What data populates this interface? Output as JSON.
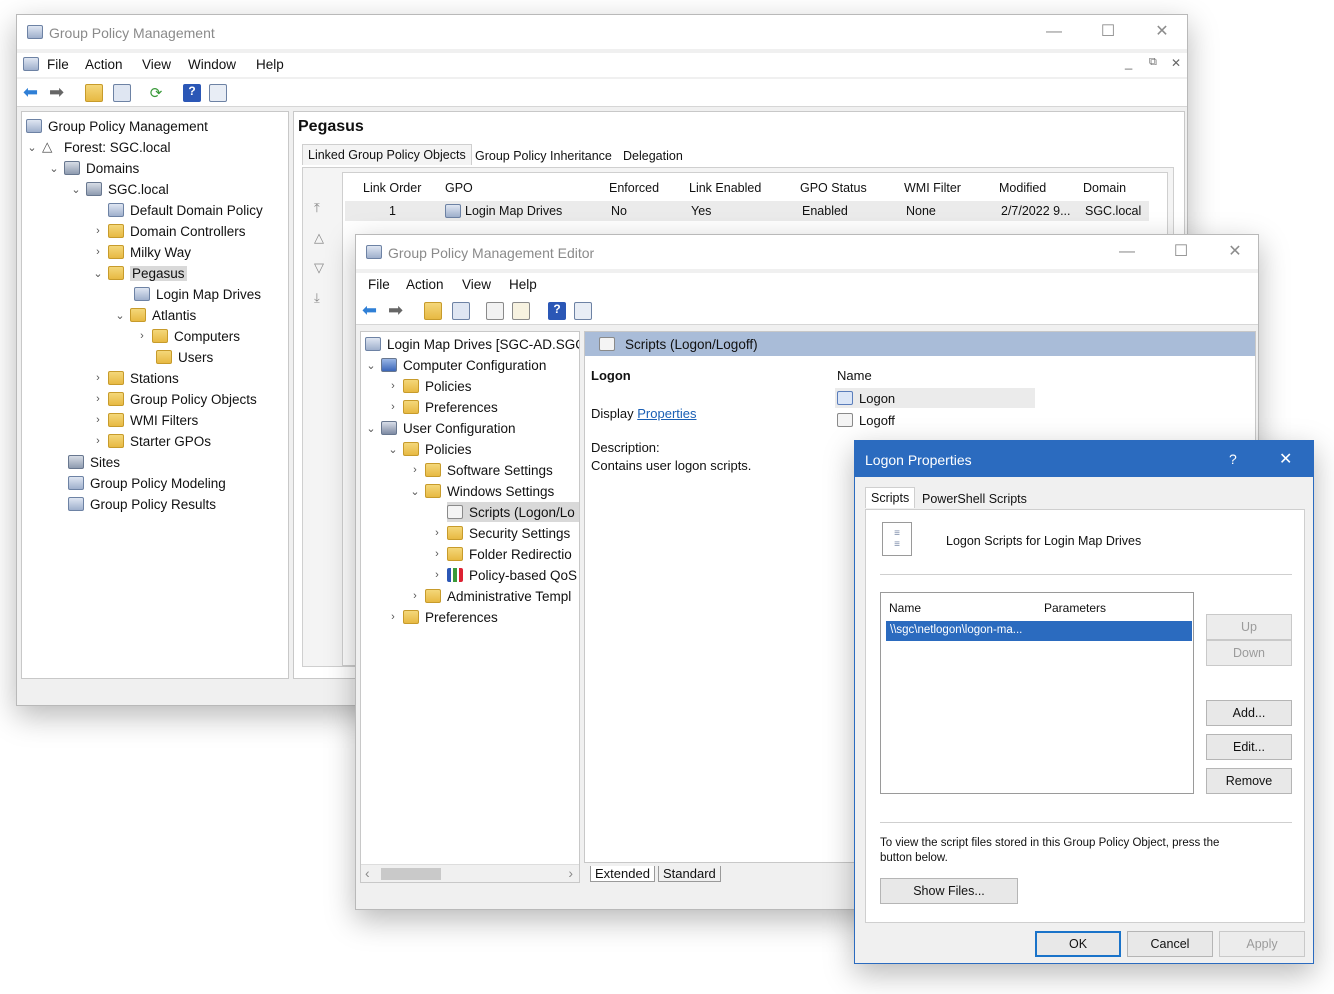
{
  "gpm": {
    "title": "Group Policy Management",
    "menu": [
      "File",
      "Action",
      "View",
      "Window",
      "Help"
    ],
    "tree": {
      "root": "Group Policy Management",
      "forest": "Forest: SGC.local",
      "domains": "Domains",
      "domain": "SGC.local",
      "default_policy": "Default Domain Policy",
      "dc": "Domain Controllers",
      "milky": "Milky Way",
      "pegasus": "Pegasus",
      "login_map": "Login Map Drives",
      "atlantis": "Atlantis",
      "computers": "Computers",
      "users": "Users",
      "stations": "Stations",
      "gpo": "Group Policy Objects",
      "wmi": "WMI Filters",
      "starter": "Starter GPOs",
      "sites": "Sites",
      "modeling": "Group Policy Modeling",
      "results": "Group Policy Results"
    },
    "content_title": "Pegasus",
    "tabs": [
      "Linked Group Policy Objects",
      "Group Policy Inheritance",
      "Delegation"
    ],
    "columns": [
      "Link Order",
      "GPO",
      "Enforced",
      "Link Enabled",
      "GPO Status",
      "WMI Filter",
      "Modified",
      "Domain"
    ],
    "rows": [
      {
        "link_order": "1",
        "gpo": "Login Map Drives",
        "enforced": "No",
        "link_enabled": "Yes",
        "status": "Enabled",
        "wmi": "None",
        "modified": "2/7/2022 9...",
        "domain": "SGC.local"
      }
    ]
  },
  "editor": {
    "title": "Group Policy Management Editor",
    "menu": [
      "File",
      "Action",
      "View",
      "Help"
    ],
    "tree": {
      "root": "Login Map Drives [SGC-AD.SGC.L",
      "computer_config": "Computer Configuration",
      "policies": "Policies",
      "preferences": "Preferences",
      "user_config": "User Configuration",
      "u_policies": "Policies",
      "software": "Software Settings",
      "windows": "Windows Settings",
      "scripts": "Scripts (Logon/Lo",
      "security": "Security Settings",
      "folder_redir": "Folder Redirectio",
      "qos": "Policy-based QoS",
      "admin_templates": "Administrative Templ",
      "u_preferences": "Preferences"
    },
    "header": "Scripts (Logon/Logoff)",
    "logon_heading": "Logon",
    "display_label": "Display",
    "properties_link": "Properties",
    "description_label": "Description:",
    "description_text": "Contains user logon scripts.",
    "name_col": "Name",
    "items": [
      "Logon",
      "Logoff"
    ],
    "bottom_tabs": [
      "Extended",
      "Standard"
    ]
  },
  "dialog": {
    "title": "Logon Properties",
    "help": "?",
    "tabs": [
      "Scripts",
      "PowerShell Scripts"
    ],
    "heading": "Logon Scripts for Login Map Drives",
    "col_name": "Name",
    "col_params": "Parameters",
    "script_row": "\\\\sgc\\netlogon\\logon-ma...",
    "buttons": {
      "up": "Up",
      "down": "Down",
      "add": "Add...",
      "edit": "Edit...",
      "remove": "Remove"
    },
    "note": "To view the script files stored in this Group Policy Object, press the button below.",
    "show_files": "Show Files...",
    "ok": "OK",
    "cancel": "Cancel",
    "apply": "Apply"
  }
}
